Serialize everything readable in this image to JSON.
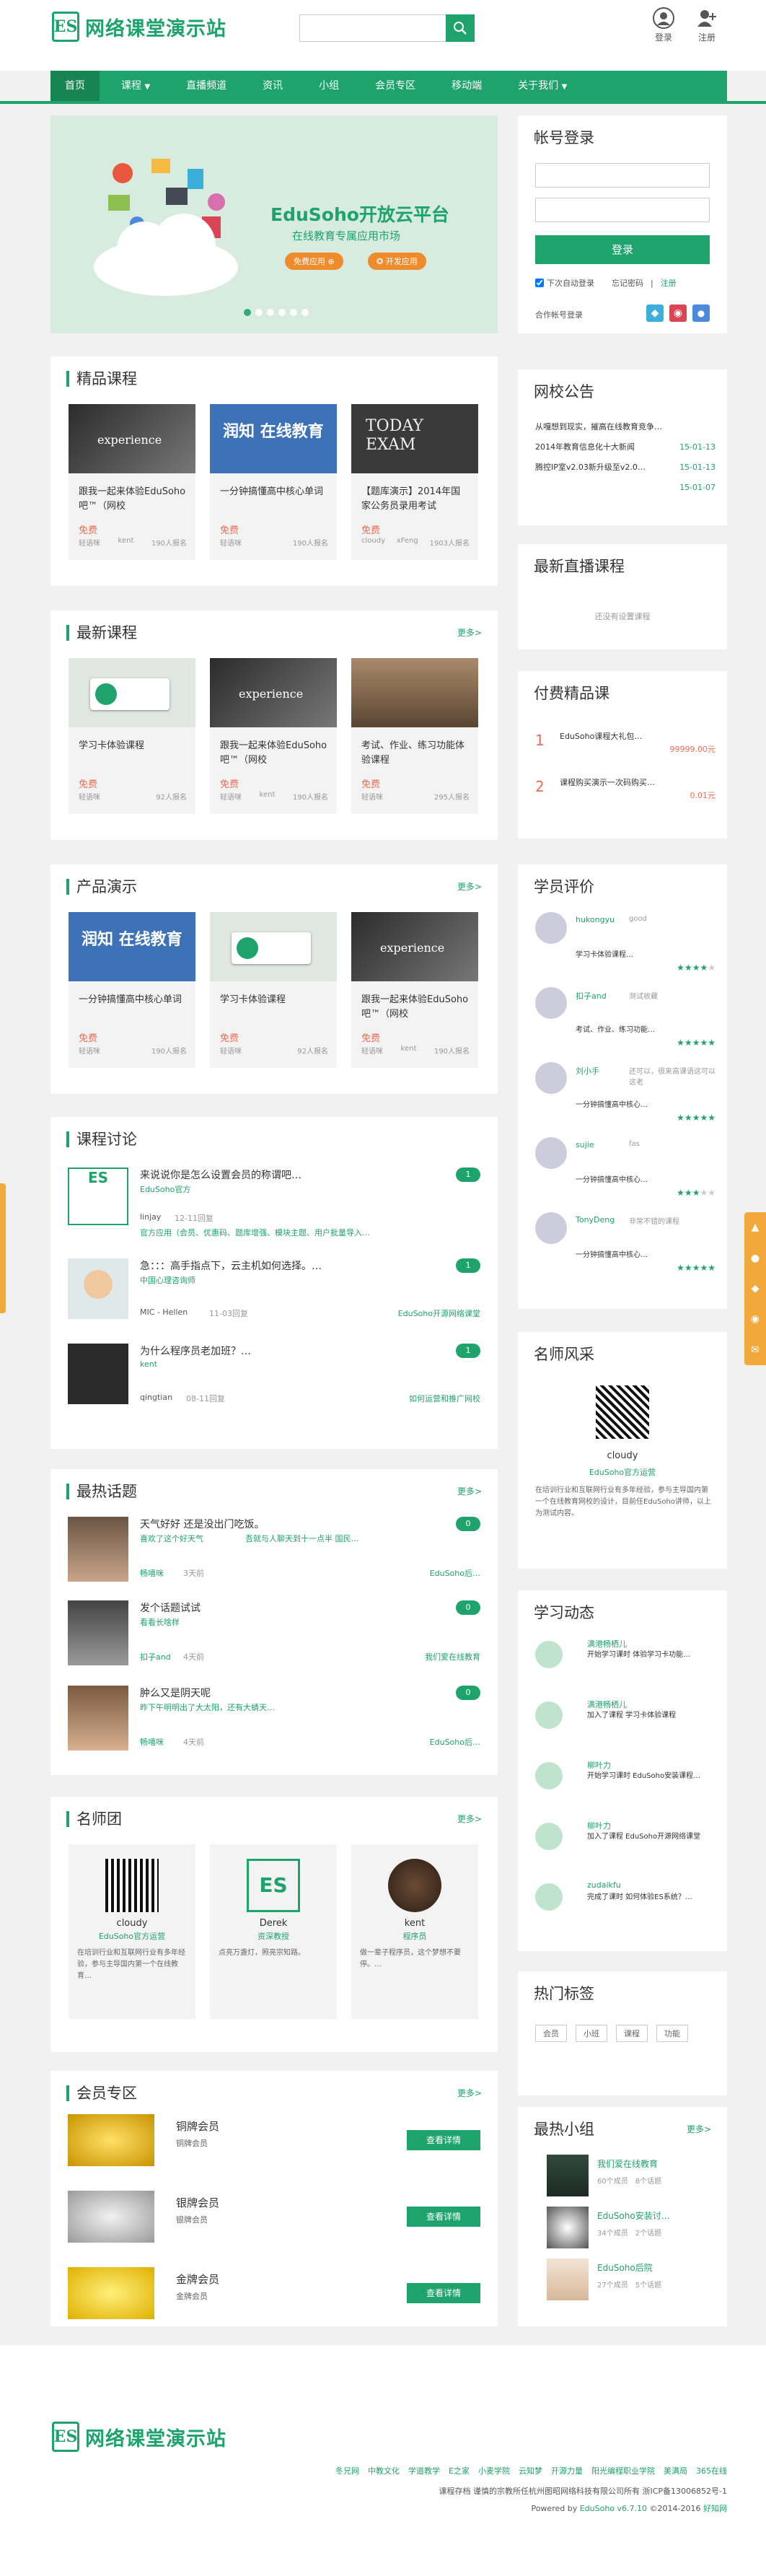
{
  "brand": {
    "name": "网络课堂演示站",
    "logo_mark": "ES"
  },
  "header": {
    "search_placeholder": "",
    "login": "登录",
    "register": "注册"
  },
  "nav": [
    "首页",
    "课程",
    "直播频道",
    "资讯",
    "小组",
    "会员专区",
    "移动端",
    "关于我们"
  ],
  "carousel": {
    "title": "EduSoho开放云平台",
    "subtitle": "在线教育专属应用市场",
    "btn1": "免费应用",
    "btn2": "开发应用",
    "slides": 6,
    "active": 1
  },
  "login": {
    "title": "帐号登录",
    "submit": "登录",
    "remember": "下次自动登录",
    "forgot": "忘记密码",
    "sep": "|",
    "register": "注册",
    "partner": "合作帐号登录"
  },
  "featured": {
    "title": "精品课程",
    "cards": [
      {
        "title": "跟我一起来体验EduSoho吧™（网校",
        "price": "免费",
        "teacher": "轻语咪",
        "author": "kent",
        "count": "190人报名",
        "thumb": "experience"
      },
      {
        "title": "一分钟搞懂高中核心单词",
        "price": "免费",
        "teacher": "轻语咪",
        "author": "",
        "count": "190人报名",
        "thumb": "runzhi"
      },
      {
        "title": "【题库演示】2014年国家公务员录用考试",
        "price": "免费",
        "teacher": "cloudy",
        "author": "xFeng",
        "count": "1903人报名",
        "thumb": "exam"
      }
    ]
  },
  "newest": {
    "title": "最新课程",
    "more": "更多>",
    "cards": [
      {
        "title": "学习卡体验课程",
        "price": "免费",
        "teacher": "轻语咪",
        "author": "",
        "count": "92人报名",
        "thumb": "card"
      },
      {
        "title": "跟我一起来体验EduSoho吧™（网校",
        "price": "免费",
        "teacher": "轻语咪",
        "author": "kent",
        "count": "190人报名",
        "thumb": "experience"
      },
      {
        "title": "考试、作业、练习功能体验课程",
        "price": "免费",
        "teacher": "轻语咪",
        "author": "",
        "count": "295人报名",
        "thumb": "class"
      }
    ]
  },
  "demo": {
    "title": "产品演示",
    "more": "更多>",
    "cards": [
      {
        "title": "一分钟搞懂高中核心单词",
        "price": "免费",
        "teacher": "轻语咪",
        "author": "",
        "count": "190人报名",
        "thumb": "runzhi"
      },
      {
        "title": "学习卡体验课程",
        "price": "免费",
        "teacher": "轻语咪",
        "author": "",
        "count": "92人报名",
        "thumb": "card"
      },
      {
        "title": "跟我一起来体验EduSoho吧™（网校",
        "price": "免费",
        "teacher": "轻语咪",
        "author": "kent",
        "count": "190人报名",
        "thumb": "experience"
      }
    ]
  },
  "discussion": {
    "title": "课程讨论",
    "items": [
      {
        "title": "来说说你是怎么设置会员的称谓吧…",
        "sub": "EduSoho官方",
        "user": "linjay",
        "time": "12-11回复",
        "count": "1",
        "source": "",
        "excerpt": "官方应用（会员、优惠码、题库增强、模块主题、用户批量导入…"
      },
      {
        "title": "急：：：高手指点下，云主机如何选择。…",
        "sub": "中国心理咨询师",
        "user": "MIC - Hellen",
        "time": "11-03回复",
        "count": "1",
        "source": "EduSoho开源网络课堂",
        "excerpt": ""
      },
      {
        "title": "为什么程序员老加班？…",
        "sub": "kent",
        "user": "qingtian",
        "time": "08-11回复",
        "count": "1",
        "source": "如何运营和推广网校",
        "excerpt": ""
      }
    ]
  },
  "topics": {
    "title": "最热话题",
    "more": "更多>",
    "items": [
      {
        "title": "天气好好 还是没出门吃饭。",
        "sub": "喜欢了这个好天气",
        "excerpt": "吾就与人聊天到十一点半 国民…",
        "user": "畅嘻咪",
        "time": "3天前",
        "count": "0",
        "source": "EduSoho后…"
      },
      {
        "title": "发个话题试试",
        "sub": "看看长啥样",
        "excerpt": "",
        "user": "扣子and",
        "time": "4天前",
        "count": "0",
        "source": "我们爱在线教育"
      },
      {
        "title": "肿么又是阴天呢",
        "sub": "昨下午明明出了大太阳，还有大蜻天…",
        "excerpt": "",
        "user": "畅嘻咪",
        "time": "4天前",
        "count": "0",
        "source": "EduSoho后…"
      }
    ]
  },
  "teachers": {
    "title": "名师团",
    "more": "更多>",
    "items": [
      {
        "name": "cloudy",
        "role": "EduSoho官方运营",
        "desc": "在培训行业和互联网行业有多年经验，参与主导国内第一个在线教育…"
      },
      {
        "name": "Derek",
        "role": "资深教授",
        "desc": "点亮万盏灯，照亮宗知路。"
      },
      {
        "name": "kent",
        "role": "程序员",
        "desc": "做一辈子程序员，这个梦想不要停。…"
      }
    ]
  },
  "vip": {
    "title": "会员专区",
    "more": "更多>",
    "items": [
      {
        "name": "铜牌会员",
        "sub": "铜牌会员",
        "btn": "查看详情",
        "tone": "gold"
      },
      {
        "name": "银牌会员",
        "sub": "银牌会员",
        "btn": "查看详情",
        "tone": "silver"
      },
      {
        "name": "金牌会员",
        "sub": "金牌会员",
        "btn": "查看详情",
        "tone": "gold2"
      }
    ]
  },
  "notices": {
    "title": "网校公告",
    "items": [
      {
        "text": "从嘎想到现实，摧高在线教育竞争…",
        "date": ""
      },
      {
        "text": "2014年教育信息化十大新闻",
        "date": "15-01-13"
      },
      {
        "text": "腾控IP室v2.03新升级至v2.0…",
        "date": "15-01-13"
      },
      {
        "text": "",
        "date": "15-01-07"
      }
    ]
  },
  "live": {
    "title": "最新直播课程",
    "empty": "还没有设置课程"
  },
  "paid": {
    "title": "付费精品课",
    "items": [
      {
        "rank": "1",
        "title": "EduSoho课程大礼包…",
        "price": "99999.00元"
      },
      {
        "rank": "2",
        "title": "课程购买演示一次码购买…",
        "price": "0.01元"
      }
    ]
  },
  "reviews": {
    "title": "学员评价",
    "items": [
      {
        "user": "hukongyu",
        "text": "good",
        "course": "学习卡体验课程…",
        "stars": 4
      },
      {
        "user": "扣子and",
        "text": "测试收藏",
        "course": "考试、作业、练习功能…",
        "stars": 5
      },
      {
        "user": "刘小手",
        "text": "还可以，很来高课语这可以这老",
        "course": "一分钟搞懂高中核心…",
        "stars": 5
      },
      {
        "user": "sujie",
        "text": "fas",
        "course": "一分钟搞懂高中核心…",
        "stars": 3
      },
      {
        "user": "TonyDeng",
        "text": "非常不错的课程",
        "course": "一分钟搞懂高中核心…",
        "stars": 5
      }
    ]
  },
  "famous": {
    "title": "名师风采",
    "name": "cloudy",
    "role": "EduSoho官方运营",
    "desc": "在培训行业和互联网行业有多年经验，参与主导国内第一个在线教育网校的设计，目前任EduSoho讲师，以上为测试内容。"
  },
  "activity": {
    "title": "学习动态",
    "items": [
      {
        "user": "满港畅栖儿",
        "text": "开始学习课时 体验学习卡功能…"
      },
      {
        "user": "满港畅栖儿",
        "text": "加入了课程 学习卡体验课程"
      },
      {
        "user": "柳叶力",
        "text": "开始学习课时 EduSoho安装课程…"
      },
      {
        "user": "柳叶力",
        "text": "加入了课程 EduSoho开源网络课堂"
      },
      {
        "user": "zudaikfu",
        "text": "完成了课时 如何体验ES系统？…"
      }
    ]
  },
  "tags": {
    "title": "热门标签",
    "items": [
      "会员",
      "小班",
      "课程",
      "功能"
    ]
  },
  "groups": {
    "title": "最热小组",
    "more": "更多>",
    "items": [
      {
        "name": "我们爱在线教育",
        "members": "60个成员",
        "topics": "8个话题"
      },
      {
        "name": "EduSoho安装讨…",
        "members": "34个成员",
        "topics": "2个话题"
      },
      {
        "name": "EduSoho后院",
        "members": "27个成员",
        "topics": "5个话题"
      }
    ]
  },
  "footer": {
    "brand": "网络课堂演示站",
    "links": [
      "冬兄网",
      "中教文化",
      "学道教学",
      "E之家",
      "小麦学院",
      "云知梦",
      "开源力量",
      "阳光编程职业学院",
      "美满局",
      "365在线"
    ],
    "copyright": "课程存档  谨慎的宗教所任杭州图昭网络科技有限公司所有  浙ICP备13006852号-1",
    "powered": "Powered by",
    "product": "EduSoho v6.7.10",
    "year": "©2014-2016",
    "link": "好知网"
  },
  "colors": {
    "brand": "#1fa36c",
    "price": "#ef6c54"
  }
}
